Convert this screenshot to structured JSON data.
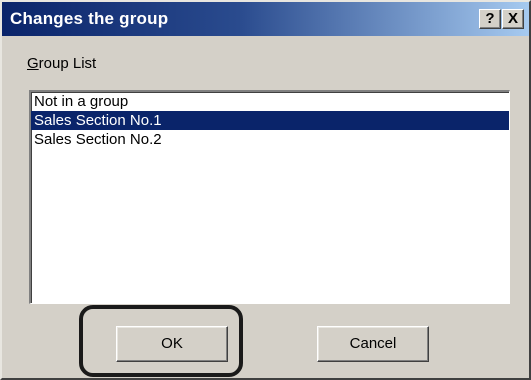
{
  "window": {
    "title": "Changes the group",
    "help_label": "?",
    "close_label": "X"
  },
  "group_list": {
    "label_mnemonic": "G",
    "label_rest": "roup List",
    "items": [
      {
        "label": "Not in a group",
        "selected": false
      },
      {
        "label": "Sales Section No.1",
        "selected": true
      },
      {
        "label": "Sales Section No.2",
        "selected": false
      }
    ]
  },
  "buttons": {
    "ok_label": "OK",
    "cancel_label": "Cancel"
  },
  "colors": {
    "title_bar": "#0a246a",
    "selection": "#0a246a",
    "dialog_face": "#d4d0c8",
    "highlight_ring": "#1a1a1a"
  }
}
